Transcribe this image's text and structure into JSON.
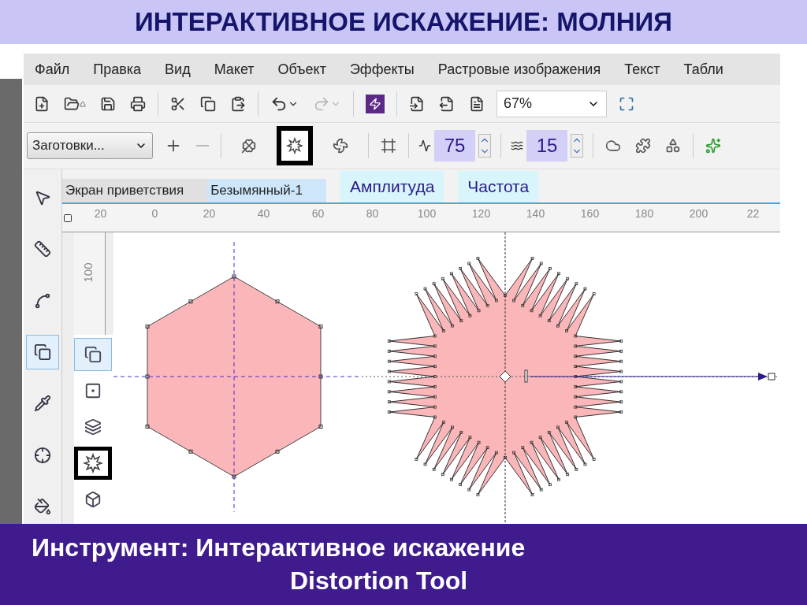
{
  "title": "ИНТЕРАКТИВНОЕ ИСКАЖЕНИЕ: МОЛНИЯ",
  "menu": [
    "Файл",
    "Правка",
    "Вид",
    "Макет",
    "Объект",
    "Эффекты",
    "Растровые изображения",
    "Текст",
    "Табли"
  ],
  "zoom": {
    "value": "67%"
  },
  "property_bar": {
    "presets": "Заготовки...",
    "modes": [
      {
        "selected": false
      },
      {
        "selected": true
      },
      {
        "selected": false
      }
    ],
    "amplitude": "75",
    "frequency": "15"
  },
  "tabs": [
    {
      "label": "Экран приветствия",
      "selected": false
    },
    {
      "label": "Безымянный-1",
      "selected": true
    }
  ],
  "callouts": [
    "Амплитуда",
    "Частота"
  ],
  "ruler": {
    "horizontal": [
      "20",
      "0",
      "20",
      "40",
      "60",
      "80",
      "100",
      "120",
      "140",
      "160",
      "180",
      "200",
      "22"
    ],
    "vertical": [
      "100"
    ]
  },
  "toolbox": [
    {
      "selected": false
    },
    {
      "selected": false
    },
    {
      "selected": false
    },
    {
      "selected": true
    },
    {
      "selected": false
    },
    {
      "selected": false
    },
    {
      "selected": false
    }
  ],
  "flyout": [
    {
      "selected": true,
      "framed": false
    },
    {
      "selected": false,
      "framed": false
    },
    {
      "selected": false,
      "framed": false
    },
    {
      "selected": false,
      "framed": true
    },
    {
      "selected": false,
      "framed": false
    }
  ],
  "caption": {
    "line1": "Инструмент: Интерактивное искажение",
    "line2": "Distortion Tool"
  }
}
